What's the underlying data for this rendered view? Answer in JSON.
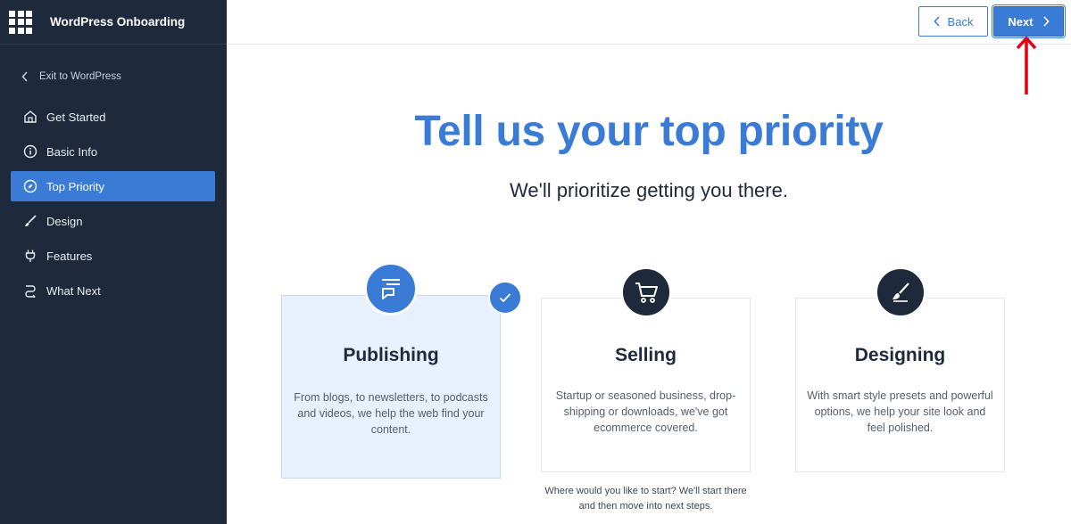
{
  "app": {
    "title": "WordPress Onboarding"
  },
  "sidebar": {
    "exit_label": "Exit to WordPress",
    "items": [
      {
        "label": "Get Started",
        "icon": "home-icon",
        "active": false
      },
      {
        "label": "Basic Info",
        "icon": "info-icon",
        "active": false
      },
      {
        "label": "Top Priority",
        "icon": "compass-icon",
        "active": true
      },
      {
        "label": "Design",
        "icon": "brush-icon",
        "active": false
      },
      {
        "label": "Features",
        "icon": "plug-icon",
        "active": false
      },
      {
        "label": "What Next",
        "icon": "route-icon",
        "active": false
      }
    ]
  },
  "toolbar": {
    "back_label": "Back",
    "next_label": "Next"
  },
  "main": {
    "title": "Tell us your top priority",
    "subtitle": "We'll prioritize getting you there.",
    "cards": [
      {
        "title": "Publishing",
        "description": "From blogs, to newsletters, to podcasts and videos, we help the web find your content.",
        "icon": "publishing-icon",
        "selected": true
      },
      {
        "title": "Selling",
        "description": "Startup or seasoned business, drop-shipping or downloads, we've got ecommerce covered.",
        "icon": "cart-icon",
        "selected": false
      },
      {
        "title": "Designing",
        "description": "With smart style presets and powerful options, we help your site look and feel polished.",
        "icon": "paintbrush-icon",
        "selected": false
      }
    ],
    "hint": "Where would you like to start? We'll start there and then move into next steps."
  },
  "colors": {
    "accent": "#3a7bd5",
    "sidebar_bg": "#1e2a3b",
    "annotation": "#e3000f"
  }
}
